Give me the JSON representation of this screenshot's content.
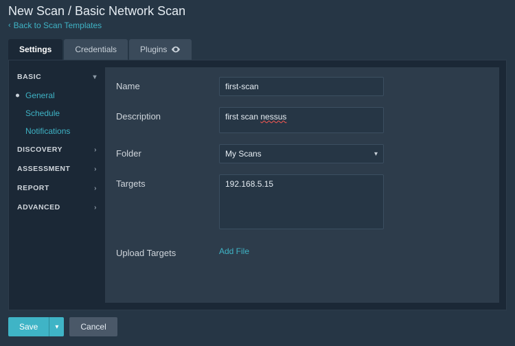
{
  "header": {
    "title": "New Scan / Basic Network Scan",
    "back_label": "Back to Scan Templates"
  },
  "tabs": {
    "settings": "Settings",
    "credentials": "Credentials",
    "plugins": "Plugins"
  },
  "sidebar": {
    "basic": "BASIC",
    "general": "General",
    "schedule": "Schedule",
    "notifications": "Notifications",
    "discovery": "DISCOVERY",
    "assessment": "ASSESSMENT",
    "report": "REPORT",
    "advanced": "ADVANCED"
  },
  "form": {
    "name_label": "Name",
    "name_value": "first-scan",
    "description_label": "Description",
    "description_value_plain": "first scan ",
    "description_value_err": "nessus",
    "folder_label": "Folder",
    "folder_value": "My Scans",
    "targets_label": "Targets",
    "targets_value": "192.168.5.15",
    "upload_label": "Upload Targets",
    "addfile_label": "Add File"
  },
  "buttons": {
    "save": "Save",
    "cancel": "Cancel"
  }
}
